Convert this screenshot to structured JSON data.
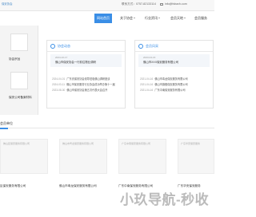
{
  "header": {
    "site_tag": "保安协会",
    "phone": "联系方式：0757-82133114",
    "email": "info@fsbaxh.com"
  },
  "nav": {
    "items": [
      {
        "label": "网站首页",
        "active": true
      },
      {
        "label": "关于协会"
      },
      {
        "label": "行业资讯"
      },
      {
        "label": "会员天地"
      },
      {
        "label": "会员服务"
      }
    ]
  },
  "sidebar": {
    "labels": [
      "协会宗旨",
      "保安公司备案材料"
    ]
  },
  "news_panel": {
    "title": "协会动态",
    "featured": {
      "date": "2024-10-17",
      "title": "佛山市保安协会一行前往物业调研"
    },
    "items": [
      {
        "date": "2024-04-01",
        "title": "广东省保安协会领导莅临佛山调研座谈"
      },
      {
        "date": "2024-03-11",
        "title": "佛山市保安服务行业协会成功举办第十一届"
      },
      {
        "date": "2023-08-30",
        "title": "佛山市保安协会第五次代表大会召开"
      }
    ]
  },
  "member_panel": {
    "title": "会员风采",
    "featured": {
      "date": "2023-04-16",
      "title": "佛山市XXX保安服务有限公司"
    },
    "items": [
      {
        "date": "2021-04-16",
        "title": "佛山市粤龙保安服务有限公司"
      },
      {
        "date": "2021-04-16",
        "title": "佛山市旗舰保安服务有限公司"
      },
      {
        "date": "2021-04-16",
        "title": "广东中南保安服务有限公司"
      }
    ]
  },
  "members_section": {
    "title": "会员单位",
    "cards": [
      {
        "caption": "佛山区保安服务有限公司",
        "name": "区保安服务有限公司"
      },
      {
        "caption": "佛山市粤龙保安服务有限公司",
        "name": "佛山市粤龙保安服务有限公司"
      },
      {
        "caption": "广东中南保安服务有限公司",
        "name": "广东中南保安服务有限公司"
      },
      {
        "caption": "广东华安保安服务",
        "name": "广东华安保安服务"
      }
    ]
  },
  "watermark": "小玖导航-秒收",
  "colors": {
    "accent": "#3a8ee6",
    "text": "#333333"
  }
}
